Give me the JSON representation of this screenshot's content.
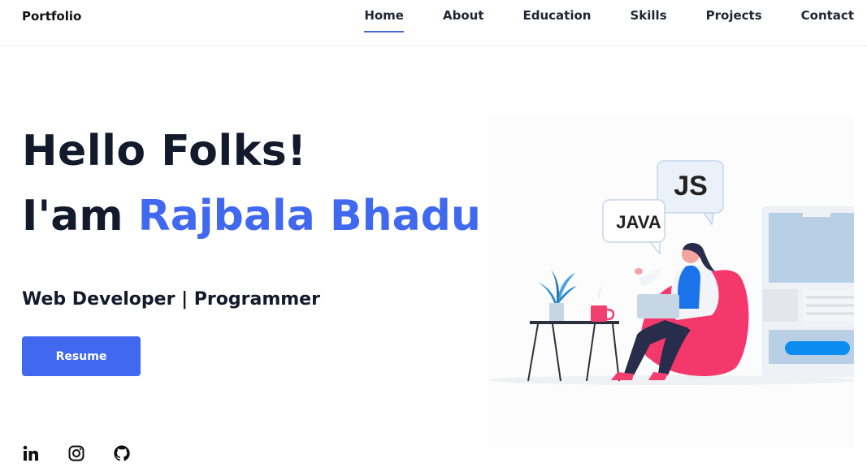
{
  "nav": {
    "brand": "Portfolio",
    "links": [
      "Home",
      "About",
      "Education",
      "Skills",
      "Projects",
      "Contact"
    ],
    "active": "Home",
    "accent_color": "#4a6bd8"
  },
  "hero": {
    "greeting": "Hello Folks!",
    "intro_prefix": "I'am",
    "name": "Rajbala Bhadu",
    "role": "Web Developer | Programmer",
    "resume_label": "Resume",
    "name_color": "#4169ef"
  },
  "illustration": {
    "bubble_back": "JS",
    "bubble_front": "JAVA"
  },
  "socials": [
    {
      "icon": "linkedin-icon"
    },
    {
      "icon": "instagram-icon"
    },
    {
      "icon": "github-icon"
    }
  ]
}
